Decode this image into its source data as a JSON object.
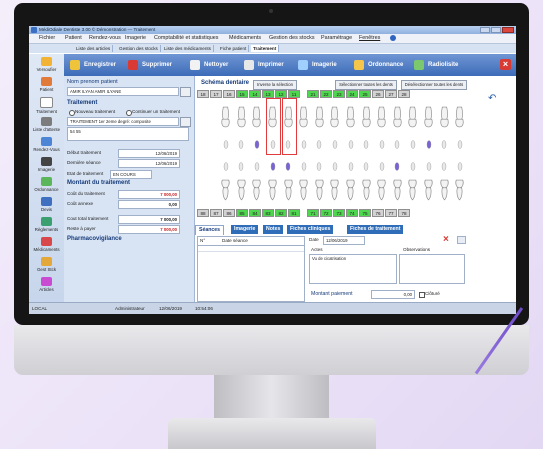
{
  "window": {
    "title": "MédiOdiale Dentiste 3.00 © Démonstration — Traitement"
  },
  "menu": [
    "Fichier",
    "Patient",
    "Rendez-vous",
    "Imagerie",
    "Comptabilité et statistiques",
    "Médicaments",
    "Gestion des stocks",
    "Paramétrage",
    "Fenêtres"
  ],
  "tabs": [
    "Liste des articles",
    "Gestion des stocks",
    "Liste des médicaments",
    "Fiche patient",
    "Traitement"
  ],
  "toolbar": {
    "enregistrer": "Enregistrer",
    "supprimer": "Supprimer",
    "nettoyer": "Nettoyer",
    "imprimer": "Imprimer",
    "imagerie": "Imagerie",
    "ordonnance": "Ordonnance",
    "radiolisite": "Radiolisite"
  },
  "sidebar": [
    "Versoufier",
    "Patient",
    "Traitement",
    "Liste d'attente",
    "Rendez-Vous",
    "Imagerie",
    "Ordonnance",
    "Devis",
    "Règlements",
    "Médicaments",
    "Gest Stck",
    "Articles"
  ],
  "patient": {
    "name_label": "Nom prenom patient",
    "name_value": "AMIR ILYAN AMIR ILYANE",
    "traitement_heading": "Traitement",
    "nouveau": "Nouveau traitement",
    "continuer": "Continuer un traitement",
    "traitement_value": "TRAITEMENT 1er 2eme degré: composite",
    "code": "54 55",
    "debut_label": "Début traitement",
    "debut_value": "12/06/2019",
    "derniere_label": "Dernière séance",
    "derniere_value": "12/06/2019",
    "etat_label": "Etat de traitement",
    "etat_value": "EN COURS",
    "montant_heading": "Montant du traitement",
    "cout_label": "Coût du traitement",
    "cout_value": "7 000,00",
    "annexe_label": "Coût annexe",
    "annexe_value": "0,00",
    "total_label": "Cout total traitement",
    "total_value": "7 000,00",
    "reste_label": "Reste à payer",
    "reste_value": "7 000,00",
    "pharma_heading": "Pharmacovigilance"
  },
  "schema": {
    "title": "Schéma dentaire",
    "inverse_btn": "Inverse la sélection",
    "select_all_btn": "Sélectionner toutes les dents",
    "deselect_all_btn": "Désélectionner toutes les dents",
    "upper_numbers": [
      "18",
      "17",
      "16",
      "15",
      "14",
      "13",
      "12",
      "11",
      "21",
      "22",
      "23",
      "24",
      "25",
      "26",
      "27",
      "28"
    ],
    "lower_numbers": [
      "88",
      "87",
      "86",
      "85",
      "84",
      "83",
      "82",
      "81",
      "71",
      "72",
      "73",
      "74",
      "75",
      "76",
      "77",
      "78"
    ],
    "upper_green": [
      false,
      false,
      false,
      true,
      true,
      true,
      true,
      true,
      true,
      true,
      true,
      true,
      true,
      false,
      false,
      false
    ],
    "lower_green": [
      false,
      false,
      false,
      true,
      true,
      true,
      true,
      true,
      true,
      true,
      true,
      true,
      true,
      false,
      false,
      false
    ],
    "colors": {
      "selected": "#4fd64f",
      "unselected": "#d3d3d3",
      "highlight": "#e23b3b",
      "treated": "#7a63d6"
    }
  },
  "seances": {
    "tabs": [
      "Séances",
      "Imagerie",
      "Notes",
      "Fiches cliniques",
      "Fiches de traitement"
    ],
    "col_no": "N°",
    "col_date": "Date séance",
    "date_label": "Date",
    "date_value": "12/06/2019",
    "actes_label": "Actes",
    "observations_label": "Observations",
    "acte_text": "Vu de cicatrisation",
    "montant_label": "Montant paiement",
    "montant_value": "0,00",
    "cloture": "Clôturé"
  },
  "status": {
    "left": "LOCAL",
    "user": "Administrateur",
    "date": "12/06/2019",
    "time": "10:54:06"
  }
}
